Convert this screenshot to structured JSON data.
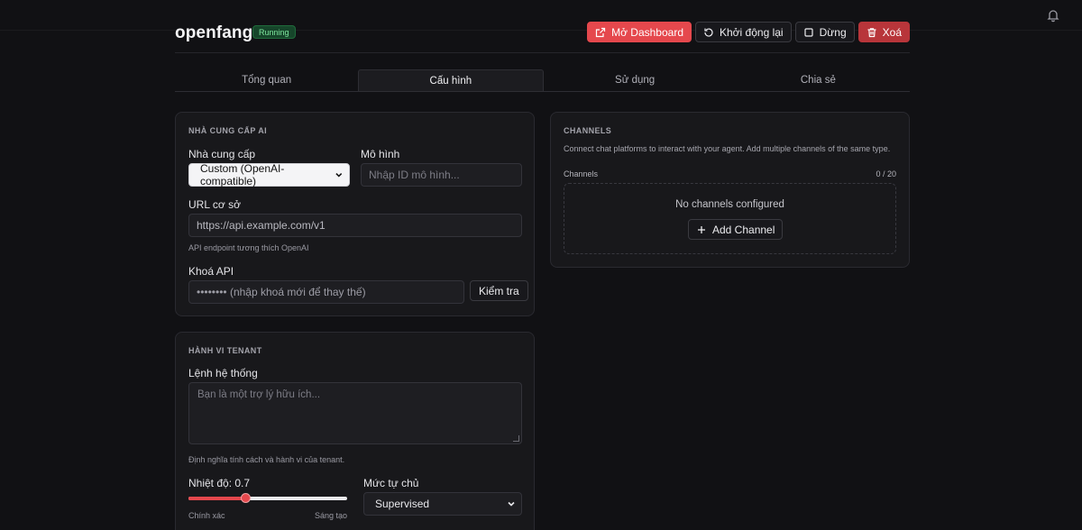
{
  "app": {
    "title": "openfang",
    "status": "Running"
  },
  "actions": {
    "open_dashboard": "Mở Dashboard",
    "restart": "Khởi động lại",
    "stop": "Dừng",
    "delete": "Xoá"
  },
  "tabs": [
    {
      "label": "Tổng quan",
      "active": false
    },
    {
      "label": "Cấu hình",
      "active": true
    },
    {
      "label": "Sử dụng",
      "active": false
    },
    {
      "label": "Chia sẻ",
      "active": false
    }
  ],
  "provider_card": {
    "title": "NHÀ CUNG CẤP AI",
    "provider_label": "Nhà cung cấp",
    "provider_value": "Custom (OpenAI-compatible)",
    "model_label": "Mô hình",
    "model_placeholder": "Nhập ID mô hình...",
    "base_url_label": "URL cơ sở",
    "base_url_value": "https://api.example.com/v1",
    "base_url_hint": "API endpoint tương thích OpenAI",
    "api_key_label": "Khoá API",
    "api_key_placeholder": "•••••••• (nhập khoá mới để thay thế)",
    "test_button": "Kiểm tra"
  },
  "tenant_card": {
    "title": "HÀNH VI TENANT",
    "system_prompt_label": "Lệnh hệ thống",
    "system_prompt_placeholder": "Bạn là một trợ lý hữu ích...",
    "system_prompt_hint": "Định nghĩa tính cách và hành vi của tenant.",
    "temperature_label": "Nhiệt độ: 0.7",
    "temperature_value": 0.7,
    "temperature_fill_fraction": 0.36,
    "temp_min_label": "Chính xác",
    "temp_max_label": "Sáng tạo",
    "autonomy_label": "Mức tự chủ",
    "autonomy_value": "Supervised"
  },
  "channels_card": {
    "title": "CHANNELS",
    "description": "Connect chat platforms to interact with your agent. Add multiple channels of the same type.",
    "count_label": "Channels",
    "count_value": "0 / 20",
    "empty_text": "No channels configured",
    "add_button": "Add Channel"
  },
  "colors": {
    "accent": "#e5484d",
    "danger": "#b8353a",
    "background": "#111114",
    "card": "#18181b",
    "status_running": "#7ee59d"
  }
}
